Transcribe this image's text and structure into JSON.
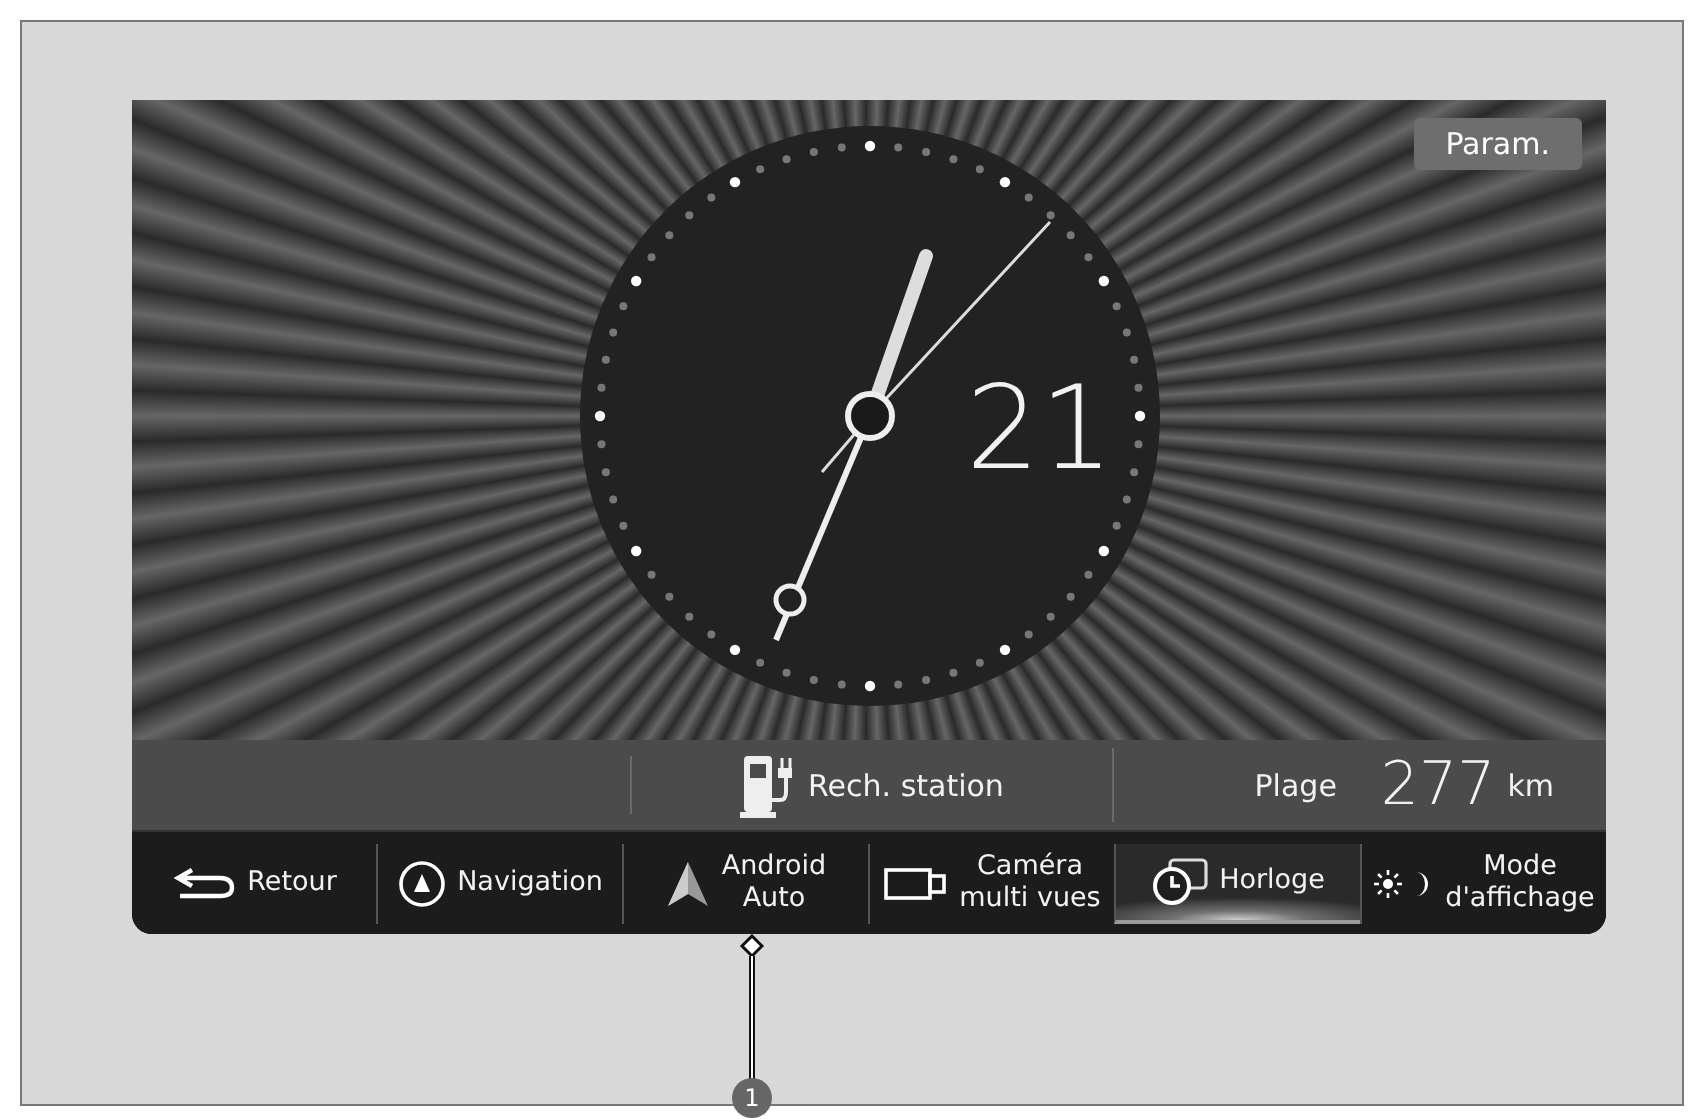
{
  "settings_button": "Param.",
  "clock": {
    "date": "21"
  },
  "info_bar": {
    "charging_station": "Rech. station",
    "range_label": "Plage",
    "range_value": "277",
    "range_unit": "km"
  },
  "nav": [
    {
      "kind": "back",
      "lines": [
        "Retour"
      ],
      "selected": false
    },
    {
      "kind": "navigation",
      "lines": [
        "Navigation"
      ],
      "selected": false
    },
    {
      "kind": "android",
      "lines": [
        "Android",
        "Auto"
      ],
      "selected": false
    },
    {
      "kind": "camera",
      "lines": [
        "Caméra",
        "multi vues"
      ],
      "selected": false
    },
    {
      "kind": "clock",
      "lines": [
        "Horloge"
      ],
      "selected": true
    },
    {
      "kind": "display",
      "lines": [
        "Mode",
        "d'affichage"
      ],
      "selected": false
    }
  ],
  "callout": "1"
}
